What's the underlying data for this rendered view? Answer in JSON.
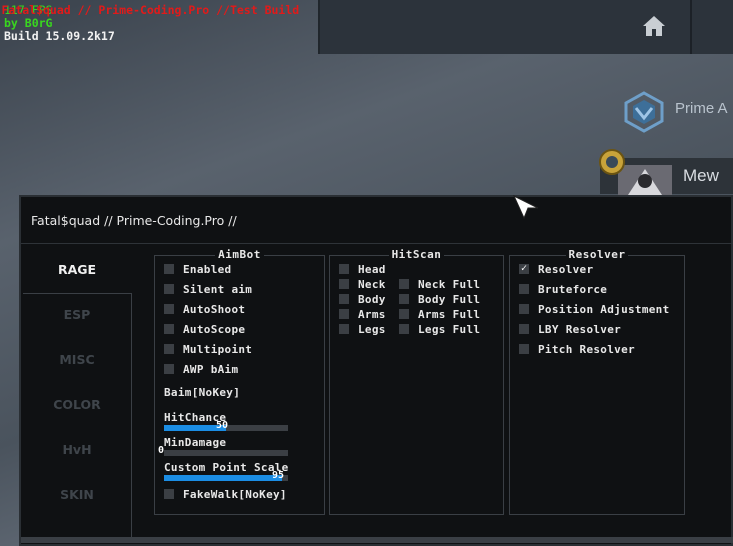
{
  "watermark": {
    "fps": "117 FPS",
    "title": "Fatal$quad // Prime-Coding.Pro //Test Build",
    "by": "by B0rG",
    "build": "Build 15.09.2k17"
  },
  "background": {
    "prime_text": "Prime A",
    "player_name": "Mew"
  },
  "menu": {
    "title": "Fatal$quad // Prime-Coding.Pro //",
    "tabs": [
      {
        "label": "RAGE",
        "active": true
      },
      {
        "label": "ESP",
        "active": false
      },
      {
        "label": "MISC",
        "active": false
      },
      {
        "label": "COLOR",
        "active": false
      },
      {
        "label": "HvH",
        "active": false
      },
      {
        "label": "SKIN",
        "active": false
      }
    ]
  },
  "aimbot": {
    "title": "AimBot",
    "checks": [
      {
        "label": "Enabled",
        "checked": false
      },
      {
        "label": "Silent aim",
        "checked": false
      },
      {
        "label": "AutoShoot",
        "checked": false
      },
      {
        "label": "AutoScope",
        "checked": false
      },
      {
        "label": "Multipoint",
        "checked": false
      },
      {
        "label": "AWP bAim",
        "checked": false
      }
    ],
    "baim_key": "Baim[NoKey]",
    "hitchance": {
      "label": "HitChance",
      "value": "50",
      "fraction": 0.5
    },
    "mindamage": {
      "label": "MinDamage",
      "value": "0",
      "fraction": 0
    },
    "point_scale": {
      "label": "Custom Point Scale",
      "value": "95",
      "fraction": 0.95
    },
    "fakewalk": {
      "label": "FakeWalk[NoKey]",
      "checked": false
    }
  },
  "hitscan": {
    "title": "HitScan",
    "left": [
      {
        "label": "Head",
        "checked": false
      },
      {
        "label": "Neck",
        "checked": false
      },
      {
        "label": "Body",
        "checked": false
      },
      {
        "label": "Arms",
        "checked": false
      },
      {
        "label": "Legs",
        "checked": false
      }
    ],
    "right": [
      {
        "label": "Neck Full",
        "checked": false
      },
      {
        "label": "Body Full",
        "checked": false
      },
      {
        "label": "Arms Full",
        "checked": false
      },
      {
        "label": "Legs Full",
        "checked": false
      }
    ]
  },
  "resolver": {
    "title": "Resolver",
    "checks": [
      {
        "label": "Resolver",
        "checked": true
      },
      {
        "label": "Bruteforce",
        "checked": false
      },
      {
        "label": "Position Adjustment",
        "checked": false
      },
      {
        "label": "LBY Resolver",
        "checked": false
      },
      {
        "label": "Pitch Resolver",
        "checked": false
      }
    ],
    "check_glyph": "✓"
  },
  "colors": {
    "slider_fill": "#1b8de4",
    "watermark_title": "#e11a1a",
    "watermark_green": "#39d61f"
  }
}
